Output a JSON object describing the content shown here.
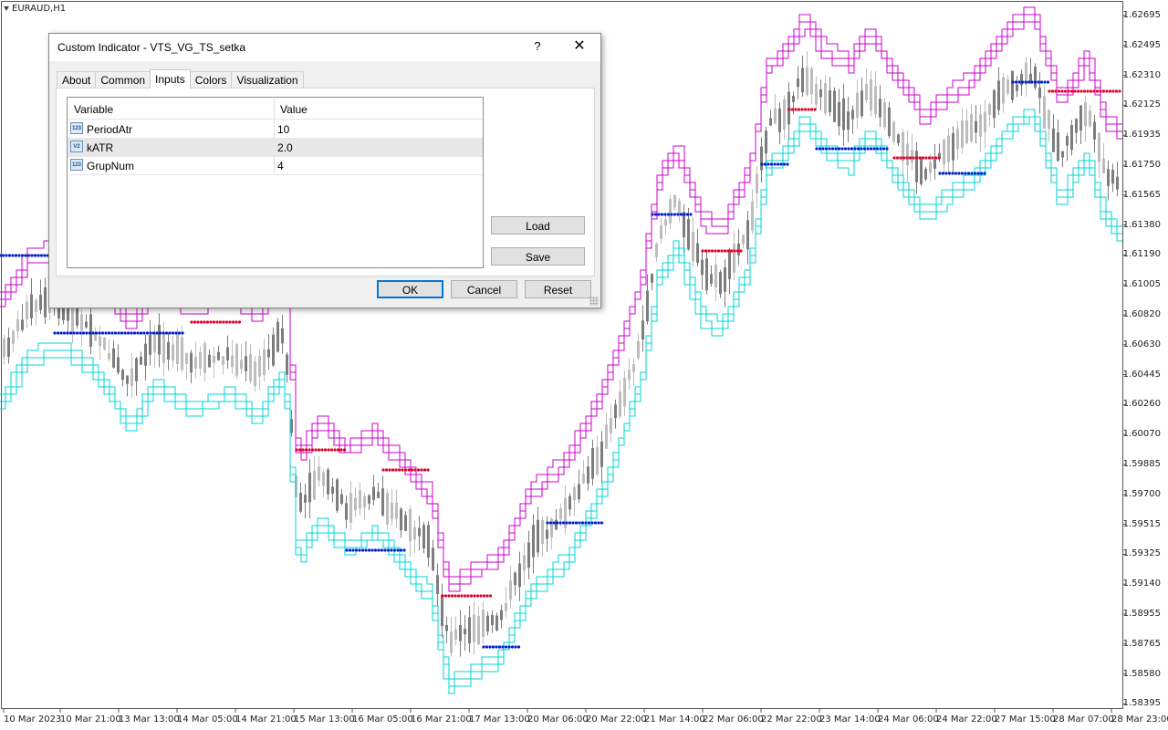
{
  "chart": {
    "symbol": "EURAUD,H1",
    "price_labels": [
      "1.62695",
      "1.62495",
      "1.62310",
      "1.62125",
      "1.61935",
      "1.61750",
      "1.61565",
      "1.61380",
      "1.61190",
      "1.61005",
      "1.60820",
      "1.60630",
      "1.60445",
      "1.60260",
      "1.60070",
      "1.59885",
      "1.59700",
      "1.59515",
      "1.59325",
      "1.59140",
      "1.58955",
      "1.58765",
      "1.58580",
      "1.58395"
    ],
    "time_labels": [
      "10 Mar 2023",
      "10 Mar 21:00",
      "13 Mar 13:00",
      "14 Mar 05:00",
      "14 Mar 21:00",
      "15 Mar 13:00",
      "16 Mar 05:00",
      "16 Mar 21:00",
      "17 Mar 13:00",
      "20 Mar 06:00",
      "20 Mar 22:00",
      "21 Mar 14:00",
      "22 Mar 06:00",
      "22 Mar 22:00",
      "23 Mar 14:00",
      "24 Mar 06:00",
      "24 Mar 22:00",
      "27 Mar 15:00",
      "28 Mar 07:00",
      "28 Mar 23:00"
    ],
    "colors": {
      "candle_bull": "#bdbdbd",
      "candle_bear": "#7d7d7d",
      "upper_band": "#cc00cc",
      "lower_band": "#00d4d4",
      "stop_red": "#e0002a",
      "stop_blue": "#0020c8"
    }
  },
  "dialog": {
    "title": "Custom Indicator - VTS_VG_TS_setka",
    "help_icon": "?",
    "close_icon": "✕",
    "tabs": [
      {
        "label": "About"
      },
      {
        "label": "Common"
      },
      {
        "label": "Inputs"
      },
      {
        "label": "Colors"
      },
      {
        "label": "Visualization"
      }
    ],
    "active_tab": "Inputs",
    "grid": {
      "header_variable": "Variable",
      "header_value": "Value",
      "rows": [
        {
          "icon": "int-param-icon",
          "icon_text": "123",
          "name": "PeriodAtr",
          "value": "10"
        },
        {
          "icon": "double-param-icon",
          "icon_text": "V2",
          "name": "kATR",
          "value": "2.0"
        },
        {
          "icon": "int-param-icon",
          "icon_text": "123",
          "name": "GrupNum",
          "value": "4"
        }
      ]
    },
    "buttons": {
      "load": "Load",
      "save": "Save",
      "ok": "OK",
      "cancel": "Cancel",
      "reset": "Reset"
    }
  }
}
